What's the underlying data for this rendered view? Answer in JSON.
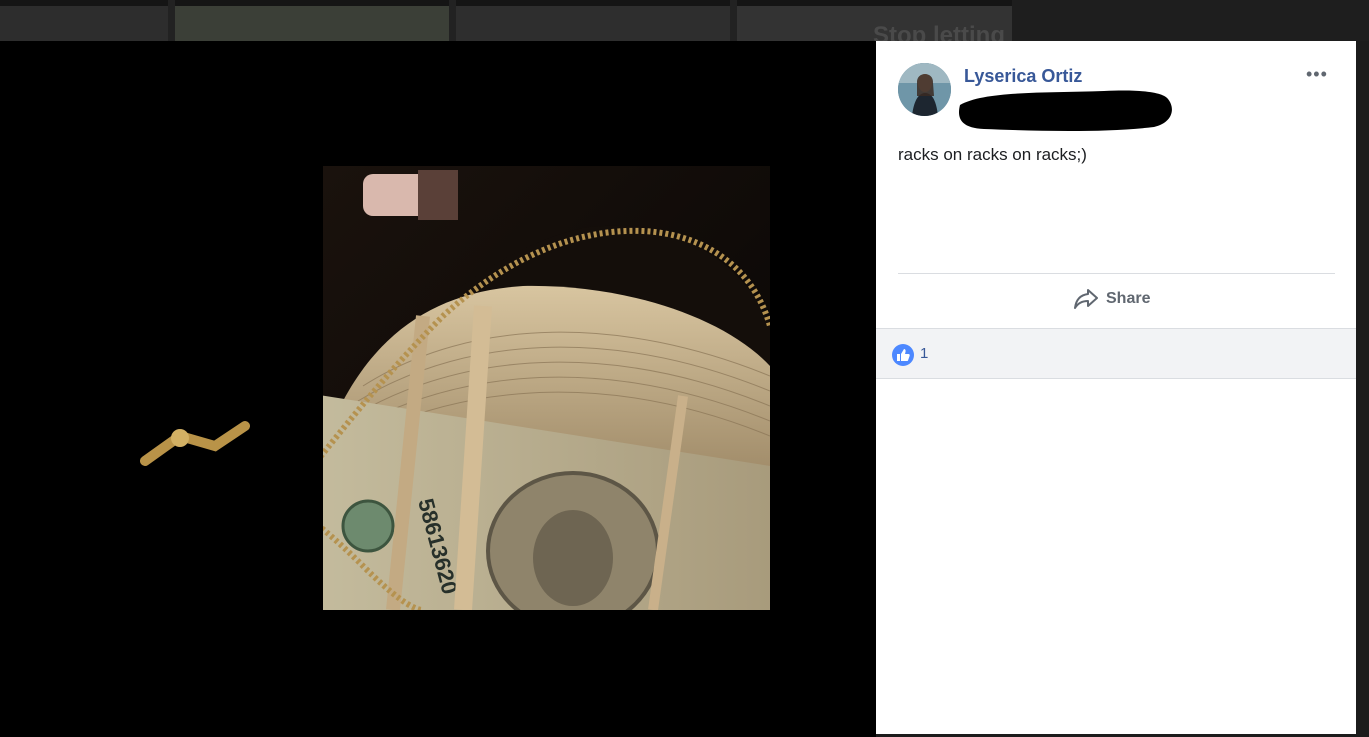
{
  "background_feed": {
    "partial_heading": "Stop letting"
  },
  "post": {
    "author_name": "Lyserica Ortiz",
    "text": "racks on racks on racks;)",
    "more_icon": "more-horizontal-icon"
  },
  "actions": {
    "share_label": "Share",
    "share_icon": "share-arrow-icon"
  },
  "reactions": {
    "like_icon": "thumbs-up-icon",
    "like_count": "1",
    "like_color": "#4d88ff"
  },
  "colors": {
    "author_link": "#385898",
    "panel_bg": "#ffffff",
    "viewer_bg": "#000000"
  }
}
